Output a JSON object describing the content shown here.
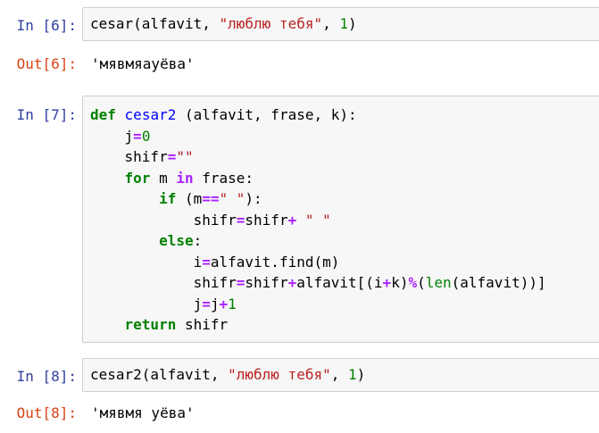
{
  "cells": [
    {
      "type": "input",
      "prompt": "In [6]:",
      "lines": [
        [
          {
            "t": "cesar(alfavit, ",
            "c": ""
          },
          {
            "t": "\"люблю тебя\"",
            "c": "str"
          },
          {
            "t": ", ",
            "c": ""
          },
          {
            "t": "1",
            "c": "num"
          },
          {
            "t": ")",
            "c": ""
          }
        ]
      ]
    },
    {
      "type": "output",
      "prompt": "Out[6]:",
      "text": "'мявмяауёва'"
    },
    {
      "type": "input",
      "prompt": "In [7]:",
      "lines": [
        [
          {
            "t": "def",
            "c": "kw"
          },
          {
            "t": " ",
            "c": ""
          },
          {
            "t": "cesar2",
            "c": "fn"
          },
          {
            "t": " (alfavit, frase, k):",
            "c": ""
          }
        ],
        [
          {
            "t": "    j",
            "c": ""
          },
          {
            "t": "=",
            "c": "op"
          },
          {
            "t": "0",
            "c": "num"
          }
        ],
        [
          {
            "t": "    shifr",
            "c": ""
          },
          {
            "t": "=",
            "c": "op"
          },
          {
            "t": "\"\"",
            "c": "str"
          }
        ],
        [
          {
            "t": "    ",
            "c": ""
          },
          {
            "t": "for",
            "c": "kw"
          },
          {
            "t": " m ",
            "c": ""
          },
          {
            "t": "in",
            "c": "op"
          },
          {
            "t": " frase:",
            "c": ""
          }
        ],
        [
          {
            "t": "        ",
            "c": ""
          },
          {
            "t": "if",
            "c": "kw"
          },
          {
            "t": " (m",
            "c": ""
          },
          {
            "t": "==",
            "c": "op"
          },
          {
            "t": "\" \"",
            "c": "str"
          },
          {
            "t": "):",
            "c": ""
          }
        ],
        [
          {
            "t": "            shifr",
            "c": ""
          },
          {
            "t": "=",
            "c": "op"
          },
          {
            "t": "shifr",
            "c": ""
          },
          {
            "t": "+",
            "c": "op"
          },
          {
            "t": " ",
            "c": ""
          },
          {
            "t": "\" \"",
            "c": "str"
          }
        ],
        [
          {
            "t": "        ",
            "c": ""
          },
          {
            "t": "else",
            "c": "kw"
          },
          {
            "t": ":",
            "c": ""
          }
        ],
        [
          {
            "t": "            i",
            "c": ""
          },
          {
            "t": "=",
            "c": "op"
          },
          {
            "t": "alfavit.find(m)",
            "c": ""
          }
        ],
        [
          {
            "t": "            shifr",
            "c": ""
          },
          {
            "t": "=",
            "c": "op"
          },
          {
            "t": "shifr",
            "c": ""
          },
          {
            "t": "+",
            "c": "op"
          },
          {
            "t": "alfavit[(i",
            "c": ""
          },
          {
            "t": "+",
            "c": "op"
          },
          {
            "t": "k)",
            "c": ""
          },
          {
            "t": "%",
            "c": "op"
          },
          {
            "t": "(",
            "c": ""
          },
          {
            "t": "len",
            "c": "bi"
          },
          {
            "t": "(alfavit))]",
            "c": ""
          }
        ],
        [
          {
            "t": "            j",
            "c": ""
          },
          {
            "t": "=",
            "c": "op"
          },
          {
            "t": "j",
            "c": ""
          },
          {
            "t": "+",
            "c": "op"
          },
          {
            "t": "1",
            "c": "num"
          }
        ],
        [
          {
            "t": "    ",
            "c": ""
          },
          {
            "t": "return",
            "c": "kw"
          },
          {
            "t": " shifr",
            "c": ""
          }
        ]
      ]
    },
    {
      "type": "input",
      "prompt": "In [8]:",
      "lines": [
        [
          {
            "t": "cesar2(alfavit, ",
            "c": ""
          },
          {
            "t": "\"люблю тебя\"",
            "c": "str"
          },
          {
            "t": ", ",
            "c": ""
          },
          {
            "t": "1",
            "c": "num"
          },
          {
            "t": ")",
            "c": ""
          }
        ]
      ]
    },
    {
      "type": "output",
      "prompt": "Out[8]:",
      "text": "'мявмя уёва'"
    }
  ],
  "colors": {
    "prompt_in": "#303f9f",
    "prompt_out": "#d84315",
    "keyword": "#008000",
    "string": "#ba2121",
    "number": "#008000",
    "operator": "#aa22ff",
    "function_def": "#0000ff",
    "cell_background": "#f7f7f7",
    "cell_border": "#cfcfcf"
  }
}
